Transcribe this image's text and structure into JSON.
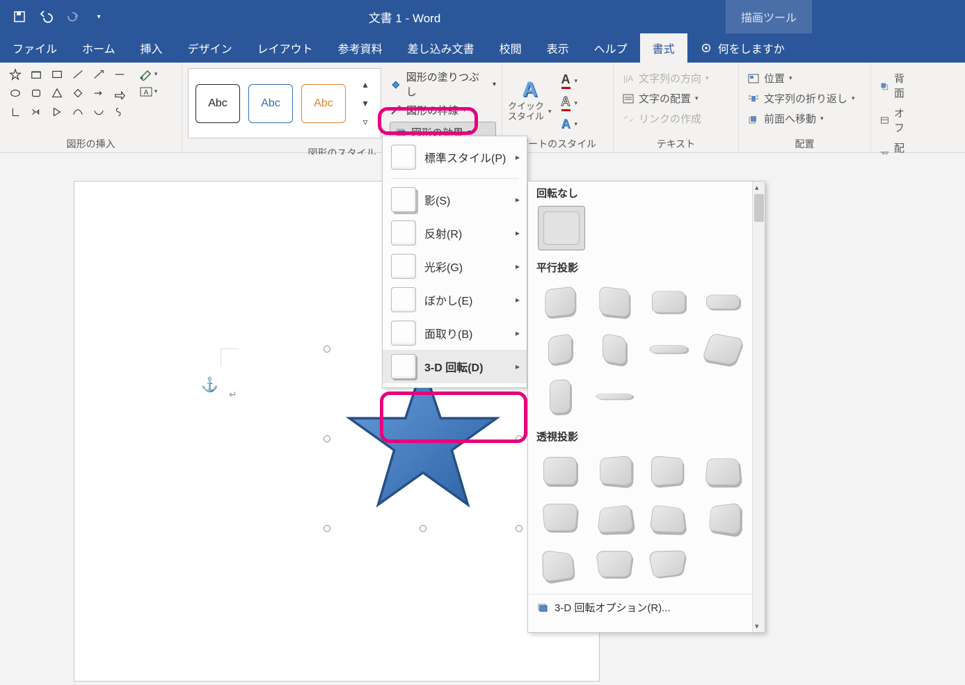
{
  "title": "文書 1  -  Word",
  "tooltab": "描画ツール",
  "tabs": [
    "ファイル",
    "ホーム",
    "挿入",
    "デザイン",
    "レイアウト",
    "参考資料",
    "差し込み文書",
    "校閲",
    "表示",
    "ヘルプ"
  ],
  "active_tab": "書式",
  "tell_me": "何をしますか",
  "groups": {
    "insert_shapes": "図形の挿入",
    "shape_styles": "図形のスタイル",
    "wordart_styles": "アートのスタイル",
    "text": "テキスト",
    "arrange": "配置"
  },
  "style_gallery": {
    "sample": "Abc"
  },
  "shape_fillout": {
    "fill": "図形の塗りつぶし",
    "outline": "図形の枠線",
    "effects": "図形の効果"
  },
  "quick_styles": "クイック\nスタイル",
  "text_group": {
    "direction": "文字列の方向",
    "align": "文字の配置",
    "link": "リンクの作成"
  },
  "arrange_group": {
    "position": "位置",
    "wrap": "文字列の折り返し",
    "forward": "前面へ移動",
    "back": "背面",
    "off": "オフ",
    "align2": "配置"
  },
  "fx_menu": [
    {
      "key": "preset",
      "label": "標準スタイル(P)"
    },
    {
      "key": "shadow",
      "label": "影(S)"
    },
    {
      "key": "reflection",
      "label": "反射(R)"
    },
    {
      "key": "glow",
      "label": "光彩(G)"
    },
    {
      "key": "soft",
      "label": "ぼかし(E)"
    },
    {
      "key": "bevel",
      "label": "面取り(B)"
    },
    {
      "key": "rot3d",
      "label": "3-D 回転(D)"
    }
  ],
  "rot_panel": {
    "none": "回転なし",
    "parallel": "平行投影",
    "perspective": "透視投影",
    "options": "3-D 回転オプション(R)..."
  }
}
